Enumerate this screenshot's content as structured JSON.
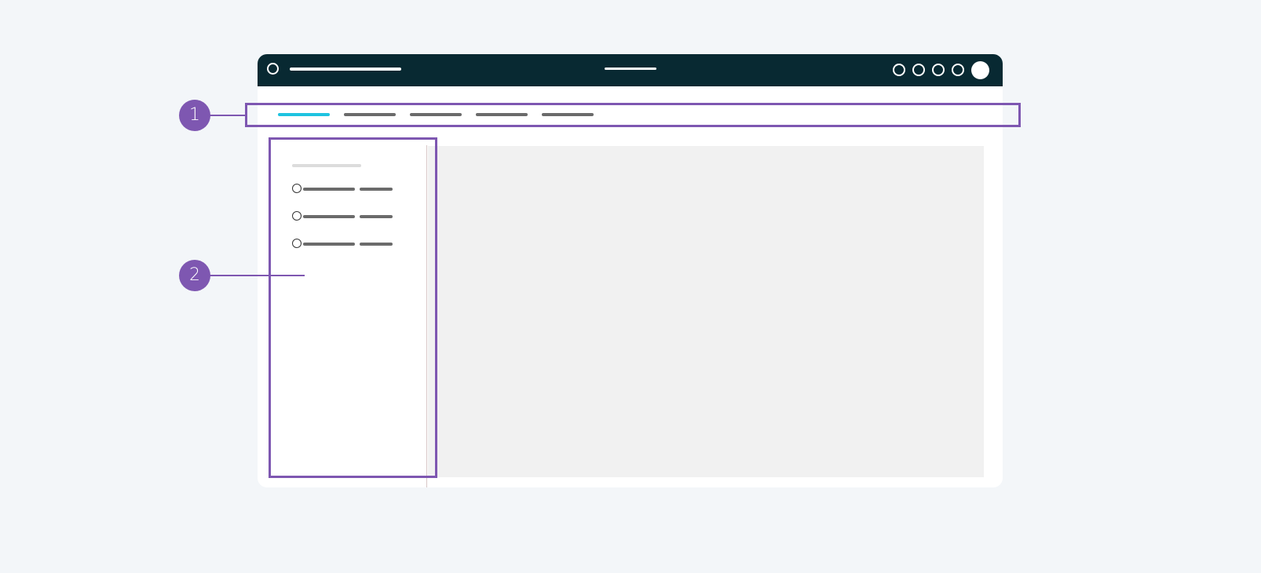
{
  "colors": {
    "page_bg": "#f3f6f9",
    "header_bg": "#082932",
    "header_fg": "#ffffff",
    "tab_active": "#1ec3e0",
    "tab_inactive": "#6b6b6b",
    "placeholder_dark": "#6b6b6b",
    "placeholder_light": "#dcdcdc",
    "content_bg": "#f1f1f1",
    "annotation": "#7e57b1"
  },
  "header": {
    "logo_icon": "logo-circle-icon",
    "utility_icons": [
      "circle-icon",
      "circle-icon",
      "circle-icon",
      "circle-icon"
    ],
    "avatar_icon": "avatar-icon"
  },
  "tabs": {
    "count": 5,
    "active_index": 0
  },
  "sidebar": {
    "row_count": 3,
    "row_icon": "radio-icon"
  },
  "annotations": [
    {
      "label": "1",
      "target": "tabs"
    },
    {
      "label": "2",
      "target": "sidebar"
    }
  ]
}
